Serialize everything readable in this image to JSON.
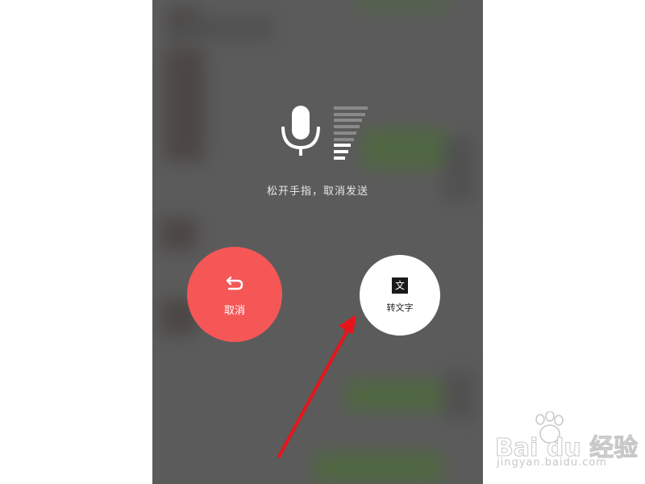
{
  "voice_overlay": {
    "hint": "松开手指，取消发送",
    "volume_level_bars": 3,
    "volume_total_bars": 9
  },
  "cancel_button": {
    "label": "取消",
    "icon": "undo-icon",
    "color": "#f55756"
  },
  "convert_button": {
    "label": "转文字",
    "icon_glyph": "文",
    "icon": "text-convert-icon"
  },
  "annotation": {
    "icon": "red-arrow",
    "color": "#e8141b"
  },
  "watermark": {
    "brand": "Bai du 经验",
    "url": "jingyan.baidu.com"
  }
}
